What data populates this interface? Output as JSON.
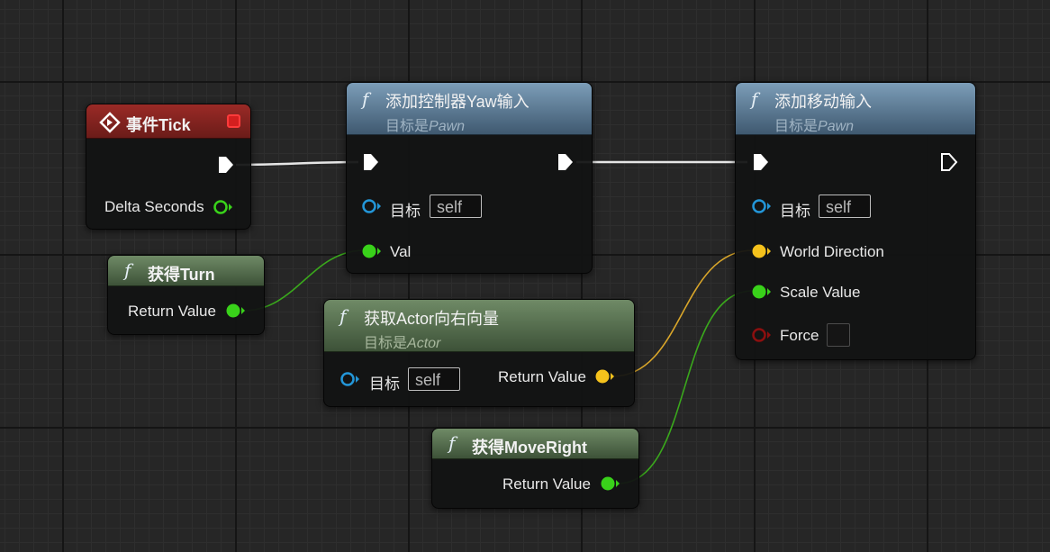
{
  "nodes": {
    "event_tick": {
      "title": "事件Tick",
      "delta_seconds_label": "Delta Seconds"
    },
    "add_yaw": {
      "title": "添加控制器Yaw输入",
      "subtitle_prefix": "目标是",
      "subtitle_class": "Pawn",
      "target_label": "目标",
      "target_value": "self",
      "val_label": "Val"
    },
    "get_turn": {
      "title": "获得Turn",
      "return_label": "Return Value"
    },
    "get_actor_right": {
      "title": "获取Actor向右向量",
      "subtitle_prefix": "目标是",
      "subtitle_class": "Actor",
      "target_label": "目标",
      "target_value": "self",
      "return_label": "Return Value"
    },
    "add_movement": {
      "title": "添加移动输入",
      "subtitle_prefix": "目标是",
      "subtitle_class": "Pawn",
      "target_label": "目标",
      "target_value": "self",
      "world_direction_label": "World Direction",
      "scale_value_label": "Scale Value",
      "force_label": "Force"
    },
    "get_moveright": {
      "title": "获得MoveRight",
      "return_label": "Return Value"
    }
  },
  "icons": {
    "function": "f",
    "event": "event-diamond-icon",
    "exec": "exec-pin-icon",
    "object": "object-pin-icon",
    "float": "float-pin-icon",
    "vector": "vector-pin-icon",
    "bool": "bool-pin-icon"
  },
  "colors": {
    "exec_wire": "#e6e6e6",
    "float_pin": "#39d21a",
    "vector_pin": "#f5c21c",
    "object_pin": "#2396d8",
    "bool_pin": "#8c0f0f",
    "event_header": "#9a2a26",
    "function_header": "#6f8fae",
    "pure_header": "#6f8a66"
  }
}
